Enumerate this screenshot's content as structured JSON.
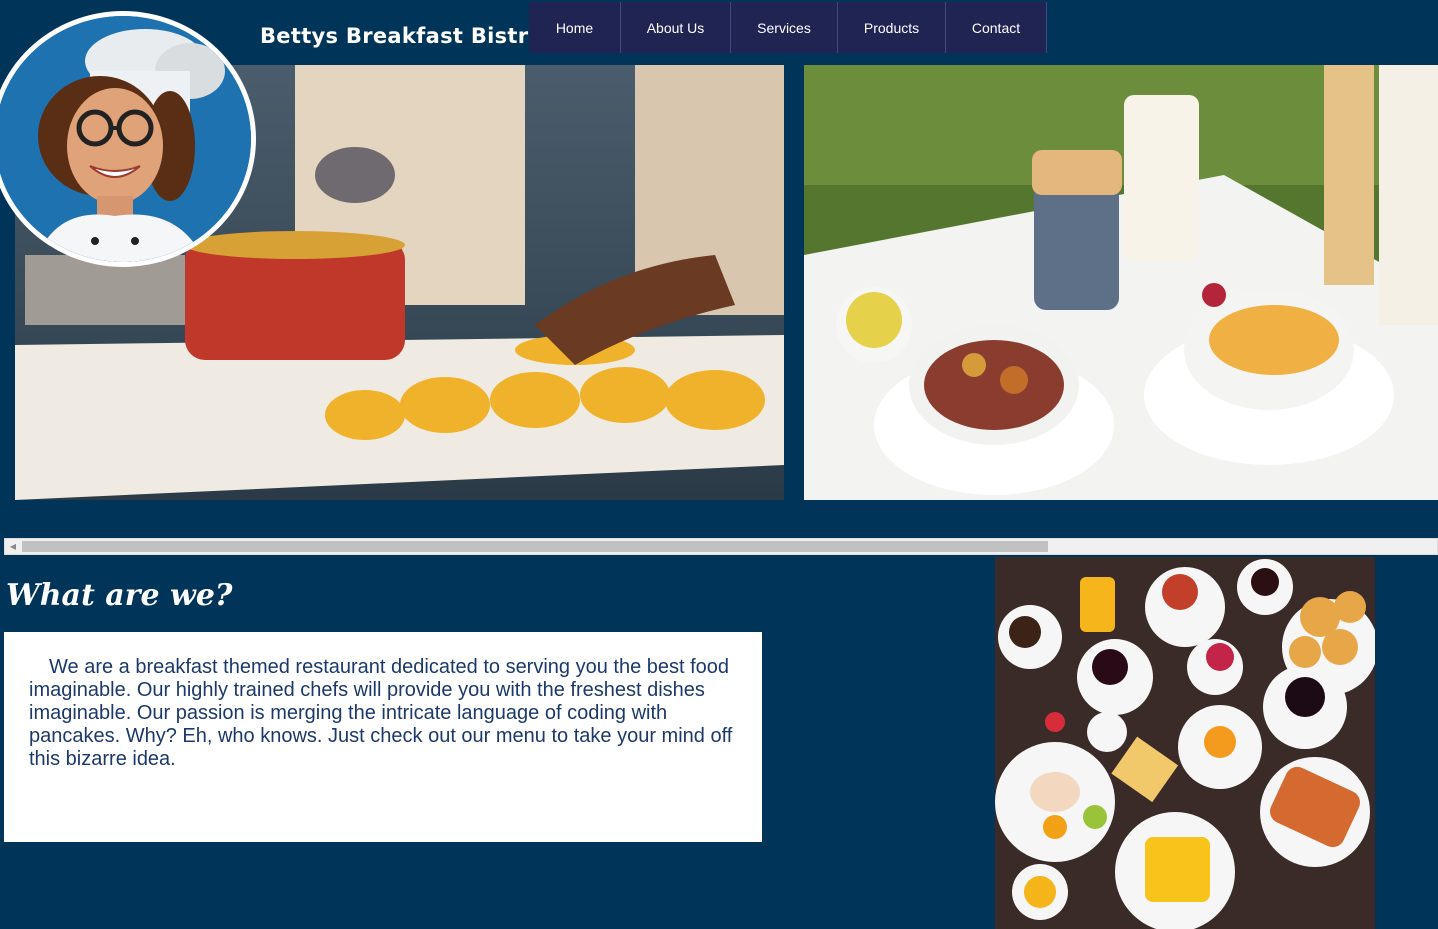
{
  "brand": {
    "title": "Bettys Breakfast Bistro"
  },
  "nav": {
    "items": [
      {
        "label": "Home"
      },
      {
        "label": "About Us"
      },
      {
        "label": "Services"
      },
      {
        "label": "Products"
      },
      {
        "label": "Contact"
      }
    ]
  },
  "about": {
    "heading": "What are we?",
    "text": "We are a breakfast themed restaurant dedicated to serving you the best food imaginable. Our highly trained chefs will provide you with the freshest dishes imaginable. Our passion is merging the intricate language of coding with pancakes. Why? Eh, who knows. Just check out our menu to take your mind off this bizarre idea."
  },
  "colors": {
    "page_background": "#003459",
    "nav_background": "#1f2453",
    "text_dark_blue": "#1b3a6b",
    "logo_background": "#1e72b0"
  },
  "scrollbar": {
    "scroll_position": 0.0,
    "visible_fraction": 0.72
  }
}
